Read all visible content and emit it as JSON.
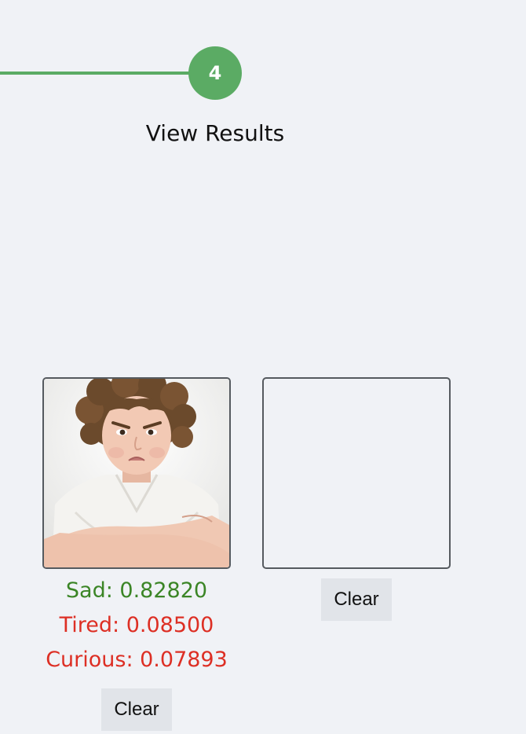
{
  "stepper": {
    "step_number": "4",
    "step_label": "View Results",
    "accent_color": "#5bab64"
  },
  "results": [
    {
      "image": "photo of pouting curly-haired boy with arms crossed",
      "scores": [
        {
          "label": "Sad",
          "value": "0.82820",
          "text": "Sad: 0.82820"
        },
        {
          "label": "Tired",
          "value": "0.08500",
          "text": "Tired: 0.08500"
        },
        {
          "label": "Curious",
          "value": "0.07893",
          "text": "Curious: 0.07893"
        }
      ],
      "clear_label": "Clear"
    },
    {
      "image": null,
      "scores": [],
      "clear_label": "Clear"
    }
  ],
  "colors": {
    "top_score": "#3b8526",
    "other_score": "#dd2f24",
    "background": "#f0f2f6"
  }
}
